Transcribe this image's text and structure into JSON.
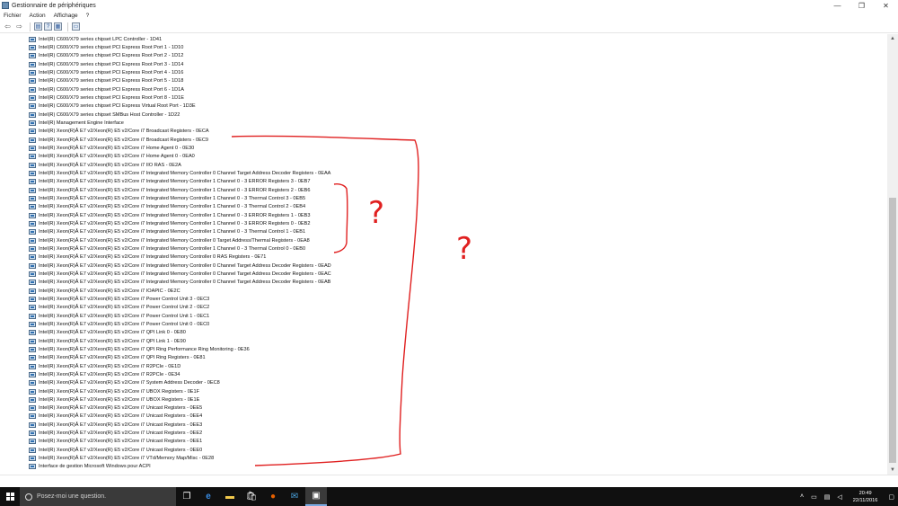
{
  "window": {
    "title": "Gestionnaire de périphériques",
    "controls": {
      "minimize": "—",
      "maximize": "❐",
      "close": "✕"
    }
  },
  "menu": {
    "items": [
      "Fichier",
      "Action",
      "Affichage",
      "?"
    ]
  },
  "devices": [
    "Intel(R) C600/X79 series chipset LPC Controller - 1D41",
    "Intel(R) C600/X79 series chipset PCI Express Root Port 1 - 1D10",
    "Intel(R) C600/X79 series chipset PCI Express Root Port 2 - 1D12",
    "Intel(R) C600/X79 series chipset PCI Express Root Port 3 - 1D14",
    "Intel(R) C600/X79 series chipset PCI Express Root Port 4 - 1D16",
    "Intel(R) C600/X79 series chipset PCI Express Root Port 5 - 1D18",
    "Intel(R) C600/X79 series chipset PCI Express Root Port 6 - 1D1A",
    "Intel(R) C600/X79 series chipset PCI Express Root Port 8 - 1D1E",
    "Intel(R) C600/X79 series chipset PCI Express Virtual Root Port - 1D3E",
    "Intel(R) C600/X79 series chipset SMBus Host Controller - 1D22",
    "Intel(R) Management Engine Interface",
    "Intel(R) Xeon(R)Â E7 v2/Xeon(R) E5 v2/Core i7 Broadcast Registers - 0ECA",
    "Intel(R) Xeon(R)Â E7 v2/Xeon(R) E5 v2/Core i7 Broadcast Registers - 0EC9",
    "Intel(R) Xeon(R)Â E7 v2/Xeon(R) E5 v2/Core i7 Home Agent 0 - 0E30",
    "Intel(R) Xeon(R)Â E7 v2/Xeon(R) E5 v2/Core i7 Home Agent 0 - 0EA0",
    "Intel(R) Xeon(R)Â E7 v2/Xeon(R) E5 v2/Core i7 IIO RAS - 0E2A",
    "Intel(R) Xeon(R)Â E7 v2/Xeon(R) E5 v2/Core i7 Integrated Memory Controller 0 Channel Target Address Decoder Registers - 0EAA",
    "Intel(R) Xeon(R)Â E7 v2/Xeon(R) E5 v2/Core i7 Integrated Memory Controller 1 Channel 0 - 3 ERROR Registers 3 - 0EB7",
    "Intel(R) Xeon(R)Â E7 v2/Xeon(R) E5 v2/Core i7 Integrated Memory Controller 1 Channel 0 - 3 ERROR Registers 2 - 0EB6",
    "Intel(R) Xeon(R)Â E7 v2/Xeon(R) E5 v2/Core i7 Integrated Memory Controller 1 Channel 0 - 3 Thermal Control 3 - 0EB5",
    "Intel(R) Xeon(R)Â E7 v2/Xeon(R) E5 v2/Core i7 Integrated Memory Controller 1 Channel 0 - 3 Thermal Control 2 - 0EB4",
    "Intel(R) Xeon(R)Â E7 v2/Xeon(R) E5 v2/Core i7 Integrated Memory Controller 1 Channel 0 - 3 ERROR Registers 1 - 0EB3",
    "Intel(R) Xeon(R)Â E7 v2/Xeon(R) E5 v2/Core i7 Integrated Memory Controller 1 Channel 0 - 3 ERROR Registers 0 - 0EB2",
    "Intel(R) Xeon(R)Â E7 v2/Xeon(R) E5 v2/Core i7 Integrated Memory Controller 1 Channel 0 - 3 Thermal Control 1 - 0EB1",
    "Intel(R) Xeon(R)Â E7 v2/Xeon(R) E5 v2/Core i7 Integrated Memory Controller 0 Target Address/Thermal Registers - 0EA8",
    "Intel(R) Xeon(R)Â E7 v2/Xeon(R) E5 v2/Core i7 Integrated Memory Controller 1 Channel 0 - 3 Thermal Control 0 - 0EB0",
    "Intel(R) Xeon(R)Â E7 v2/Xeon(R) E5 v2/Core i7 Integrated Memory Controller 0 RAS Registers - 0E71",
    "Intel(R) Xeon(R)Â E7 v2/Xeon(R) E5 v2/Core i7 Integrated Memory Controller 0 Channel Target Address Decoder Registers - 0EAD",
    "Intel(R) Xeon(R)Â E7 v2/Xeon(R) E5 v2/Core i7 Integrated Memory Controller 0 Channel Target Address Decoder Registers - 0EAC",
    "Intel(R) Xeon(R)Â E7 v2/Xeon(R) E5 v2/Core i7 Integrated Memory Controller 0 Channel Target Address Decoder Registers - 0EAB",
    "Intel(R) Xeon(R)Â E7 v2/Xeon(R) E5 v2/Core i7 IOAPIC - 0E2C",
    "Intel(R) Xeon(R)Â E7 v2/Xeon(R) E5 v2/Core i7 Power Control Unit 3 - 0EC3",
    "Intel(R) Xeon(R)Â E7 v2/Xeon(R) E5 v2/Core i7 Power Control Unit 2 - 0EC2",
    "Intel(R) Xeon(R)Â E7 v2/Xeon(R) E5 v2/Core i7 Power Control Unit 1 - 0EC1",
    "Intel(R) Xeon(R)Â E7 v2/Xeon(R) E5 v2/Core i7 Power Control Unit 0 - 0EC0",
    "Intel(R) Xeon(R)Â E7 v2/Xeon(R) E5 v2/Core i7 QPI Link 0 - 0E80",
    "Intel(R) Xeon(R)Â E7 v2/Xeon(R) E5 v2/Core i7 QPI Link 1 - 0E90",
    "Intel(R) Xeon(R)Â E7 v2/Xeon(R) E5 v2/Core i7 QPI Ring Performance Ring Monitoring - 0E36",
    "Intel(R) Xeon(R)Â E7 v2/Xeon(R) E5 v2/Core i7 QPI Ring Registers - 0E81",
    "Intel(R) Xeon(R)Â E7 v2/Xeon(R) E5 v2/Core i7 R2PCIe - 0E1D",
    "Intel(R) Xeon(R)Â E7 v2/Xeon(R) E5 v2/Core i7 R2PCIe - 0E34",
    "Intel(R) Xeon(R)Â E7 v2/Xeon(R) E5 v2/Core i7 System Address Decoder - 0EC8",
    "Intel(R) Xeon(R)Â E7 v2/Xeon(R) E5 v2/Core i7 UBOX Registers - 0E1F",
    "Intel(R) Xeon(R)Â E7 v2/Xeon(R) E5 v2/Core i7 UBOX Registers - 0E1E",
    "Intel(R) Xeon(R)Â E7 v2/Xeon(R) E5 v2/Core i7 Unicast Registers - 0EE5",
    "Intel(R) Xeon(R)Â E7 v2/Xeon(R) E5 v2/Core i7 Unicast Registers - 0EE4",
    "Intel(R) Xeon(R)Â E7 v2/Xeon(R) E5 v2/Core i7 Unicast Registers - 0EE3",
    "Intel(R) Xeon(R)Â E7 v2/Xeon(R) E5 v2/Core i7 Unicast Registers - 0EE2",
    "Intel(R) Xeon(R)Â E7 v2/Xeon(R) E5 v2/Core i7 Unicast Registers - 0EE1",
    "Intel(R) Xeon(R)Â E7 v2/Xeon(R) E5 v2/Core i7 Unicast Registers - 0EE0",
    "Intel(R) Xeon(R)Â E7 v2/Xeon(R) E5 v2/Core i7 VTd/Memory Map/Misc - 0E28",
    "Interface de gestion Microsoft Windows pour ACPI"
  ],
  "annotations": {
    "small_mark": "?",
    "large_mark": "?",
    "color": "#e02020"
  },
  "taskbar": {
    "search_placeholder": "Posez-moi une question.",
    "time": "20:49",
    "date": "22/11/2016"
  }
}
